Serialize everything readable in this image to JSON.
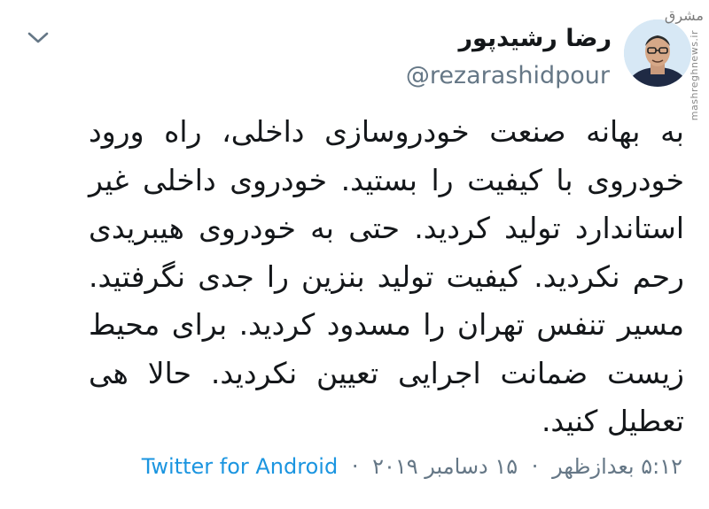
{
  "tweet": {
    "author_name": "رضا رشیدپور",
    "author_handle": "@rezarashidpour",
    "text_lines": [
      "به بهانه صنعت خودروسازی داخلی، راه ورود",
      "خودروی با کیفیت را بستید. خودروی داخلی غیر",
      "استاندارد تولید کردید. حتی به خودروی هیبریدی",
      "رحم نکردید. کیفیت تولید بنزین را جدی نگرفتید.",
      "مسیر تنفس تهران را مسدود کردید. برای محیط",
      "زیست ضمانت اجرایی تعیین نکردید. حالا هی",
      "تعطیل کنید."
    ],
    "time": "۵:۱۲ بعدازظهر",
    "date": "۱۵ دسامبر ۲۰۱۹",
    "source": "Twitter for Android",
    "separator": "·"
  },
  "watermark": {
    "logo_text": "مشرق",
    "site_text": "mashreghnews.ir"
  },
  "icons": {
    "menu": "chevron-down-icon",
    "avatar": "avatar"
  },
  "colors": {
    "text": "#14171a",
    "secondary": "#657786",
    "link": "#1b95e0"
  }
}
